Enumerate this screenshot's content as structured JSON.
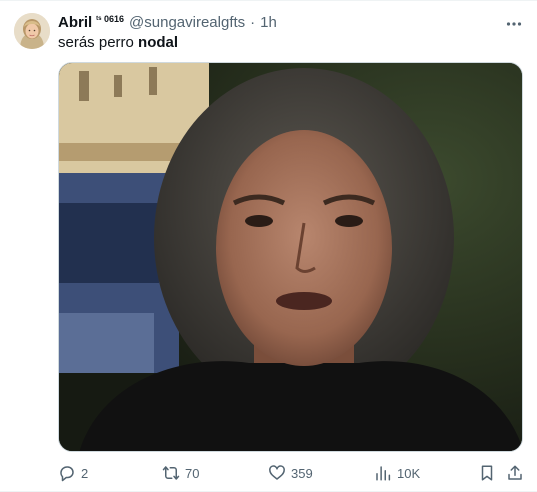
{
  "tweet": {
    "display_name": "Abril",
    "name_tag": "ᵗˢ 0616",
    "handle": "@sungavirealgfts",
    "separator": "·",
    "time": "1h",
    "text_plain": "serás perro ",
    "text_bold": "nodal"
  },
  "actions": {
    "replies": "2",
    "reposts": "70",
    "likes": "359",
    "views": "10K"
  },
  "icons": {
    "more": "more-horizontal-icon",
    "reply": "reply-icon",
    "repost": "repost-icon",
    "like": "heart-icon",
    "views": "views-icon",
    "bookmark": "bookmark-icon",
    "share": "share-icon"
  },
  "colors": {
    "text_primary": "#0f1419",
    "text_secondary": "#536471",
    "border": "#cfd9de"
  }
}
